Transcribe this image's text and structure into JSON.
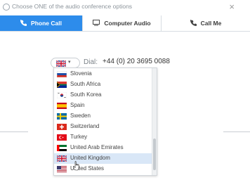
{
  "window": {
    "title": "Choose ONE of the audio conference options",
    "close_glyph": "×"
  },
  "tabs": [
    {
      "label": "Phone Call",
      "icon": "phone-icon",
      "glyph": "📞",
      "active": true
    },
    {
      "label": "Computer Audio",
      "icon": "monitor-icon",
      "glyph": "🖥",
      "active": false
    },
    {
      "label": "Call Me",
      "icon": "phone-icon",
      "glyph": "📞",
      "active": false
    }
  ],
  "dial": {
    "label": "Dial:",
    "number": "+44 (0) 20 3695 0088",
    "selected_country_flag": "united-kingdom-flag-icon",
    "caret": "▾"
  },
  "country_list": [
    {
      "name": "Slovenia",
      "flag": "slovenia-flag-icon",
      "selected": false
    },
    {
      "name": "South Africa",
      "flag": "south-africa-flag-icon",
      "selected": false
    },
    {
      "name": "South Korea",
      "flag": "south-korea-flag-icon",
      "selected": false
    },
    {
      "name": "Spain",
      "flag": "spain-flag-icon",
      "selected": false
    },
    {
      "name": "Sweden",
      "flag": "sweden-flag-icon",
      "selected": false
    },
    {
      "name": "Switzerland",
      "flag": "switzerland-flag-icon",
      "selected": false
    },
    {
      "name": "Turkey",
      "flag": "turkey-flag-icon",
      "selected": false
    },
    {
      "name": "United Arab Emirates",
      "flag": "uae-flag-icon",
      "selected": false
    },
    {
      "name": "United Kingdom",
      "flag": "united-kingdom-flag-icon",
      "selected": true
    },
    {
      "name": "United States",
      "flag": "united-states-flag-icon",
      "selected": false
    }
  ],
  "colors": {
    "accent": "#2d8ceb",
    "selected_row": "#d9e7f7"
  }
}
